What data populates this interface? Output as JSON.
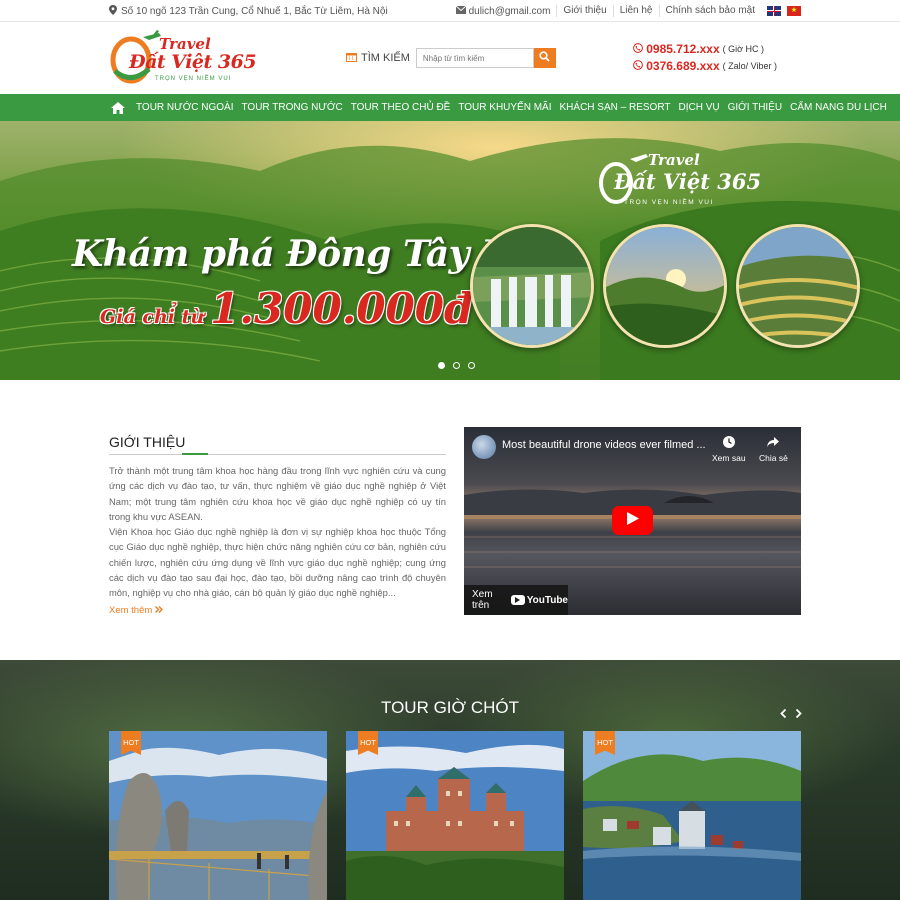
{
  "topbar": {
    "address": "Số 10 ngõ 123 Trần Cung, Cổ Nhuế 1, Bắc Từ Liêm, Hà Nội",
    "email": "dulich@gmail.com",
    "links": [
      "Giới thiệu",
      "Liên hệ",
      "Chính sách bảo mật"
    ]
  },
  "logo": {
    "line1": "Travel",
    "line2": "Đất Việt 365",
    "tagline": "TRỌN VẸN NIỀM VUI"
  },
  "search": {
    "label": "TÌM KIẾM",
    "placeholder": "Nhập từ tìm kiếm"
  },
  "hotline": [
    {
      "number": "0985.712.xxx",
      "note": "( Giờ HC )"
    },
    {
      "number": "0376.689.xxx",
      "note": "( Zalo/ Viber )"
    }
  ],
  "nav": [
    "TOUR NƯỚC NGOÀI",
    "TOUR TRONG NƯỚC",
    "TOUR THEO CHỦ ĐỀ",
    "TOUR KHUYẾN MÃI",
    "KHÁCH SẠN – RESORT",
    "DỊCH VỤ",
    "GIỚI THIỆU",
    "CẨM NANG DU LỊCH"
  ],
  "banner": {
    "title": "Khám phá Đông Tây Bắc",
    "price_prefix": "Giá chỉ từ",
    "price": "1.300.000đ",
    "slides": 3,
    "active_slide": 1
  },
  "intro": {
    "heading": "GIỚI THIỆU",
    "p1": "Trở thành một trung tâm khoa học hàng đầu trong lĩnh vực nghiên cứu và cung ứng các dịch vụ đào tạo, tư vấn, thực nghiệm về giáo dục nghề nghiệp ở Việt Nam; một trung tâm nghiên cứu khoa học về giáo dục nghề nghiệp có uy tín trong khu vực ASEAN.",
    "p2": "Viện Khoa học Giáo dục nghề nghiệp là đơn vị sự nghiệp khoa học thuộc Tổng cục Giáo dục nghề nghiệp, thực hiện chức năng nghiên cứu cơ bản, nghiên cứu chiến lược, nghiên cứu ứng dụng về lĩnh vực giáo dục nghề nghiệp; cung ứng các dịch vụ đào tạo sau đại học, đào tạo, bồi dưỡng nâng cao trình độ chuyên môn, nghiệp vụ cho nhà giáo, cán bộ quản lý giáo dục nghề nghiệp...",
    "more": "Xem thêm"
  },
  "video": {
    "title": "Most beautiful drone videos ever filmed ...",
    "watch_later": "Xem sau",
    "share": "Chia sẻ",
    "watch_on": "Xem trên",
    "youtube": "YouTube"
  },
  "tours": {
    "heading": "TOUR GIỜ CHÓT",
    "badge": "HOT",
    "cards": [
      {
        "scene": "golden-bridge"
      },
      {
        "scene": "quebec-castle"
      },
      {
        "scene": "norway-coast"
      }
    ]
  },
  "colors": {
    "green": "#3a9a42",
    "orange": "#ee7d22",
    "red": "#d9281f"
  }
}
